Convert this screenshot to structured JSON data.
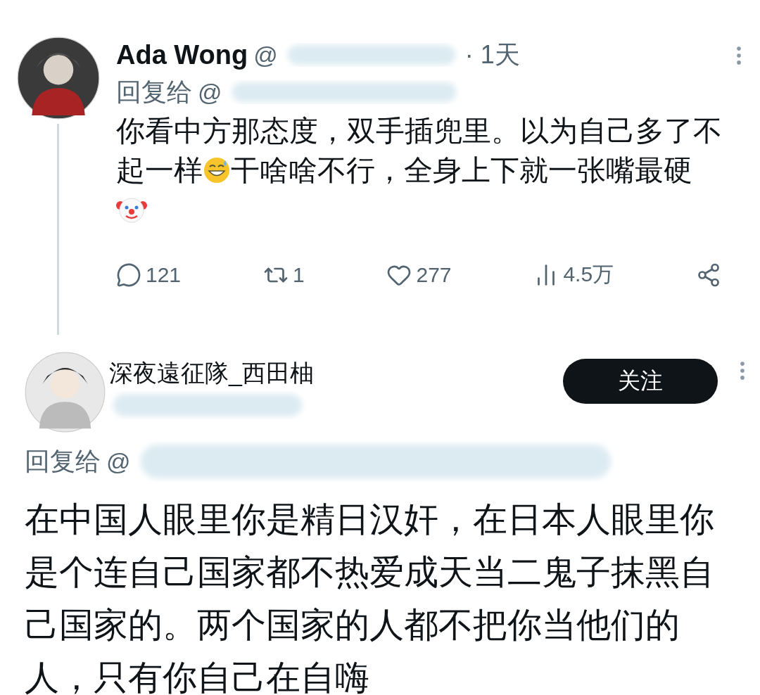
{
  "posts": [
    {
      "author": "Ada Wong",
      "handle": "@",
      "time": "· 1天",
      "reply_to": {
        "label": "回复给",
        "handle": "@"
      },
      "body": [
        {
          "kind": "text",
          "text": "你看中方那态度，双手插兜里。以为自己多了不起一样"
        },
        {
          "kind": "smile"
        },
        {
          "kind": "text",
          "text": "干啥啥不行，全身上下就一张嘴最硬"
        },
        {
          "kind": "break"
        },
        {
          "kind": "clown"
        }
      ],
      "actions": [
        {
          "kind": "reply",
          "count": "121"
        },
        {
          "kind": "repost",
          "count": "1"
        },
        {
          "kind": "like",
          "count": "277"
        },
        {
          "kind": "views",
          "count": "4.5万"
        },
        {
          "kind": "share"
        }
      ]
    },
    {
      "author": "深夜遠征隊_西田柚",
      "reply_to": {
        "label": "回复给",
        "handle": "@"
      },
      "follow": {
        "label": "关注"
      },
      "body": [
        {
          "kind": "text",
          "text": "在中国人眼里你是精日汉奸，在日本人眼里你是个连自己国家都不热爱成天当二鬼子抹黑自己国家的。两个国家的人都不把你当他们的人，只有你自己在自嗨"
        }
      ]
    }
  ]
}
